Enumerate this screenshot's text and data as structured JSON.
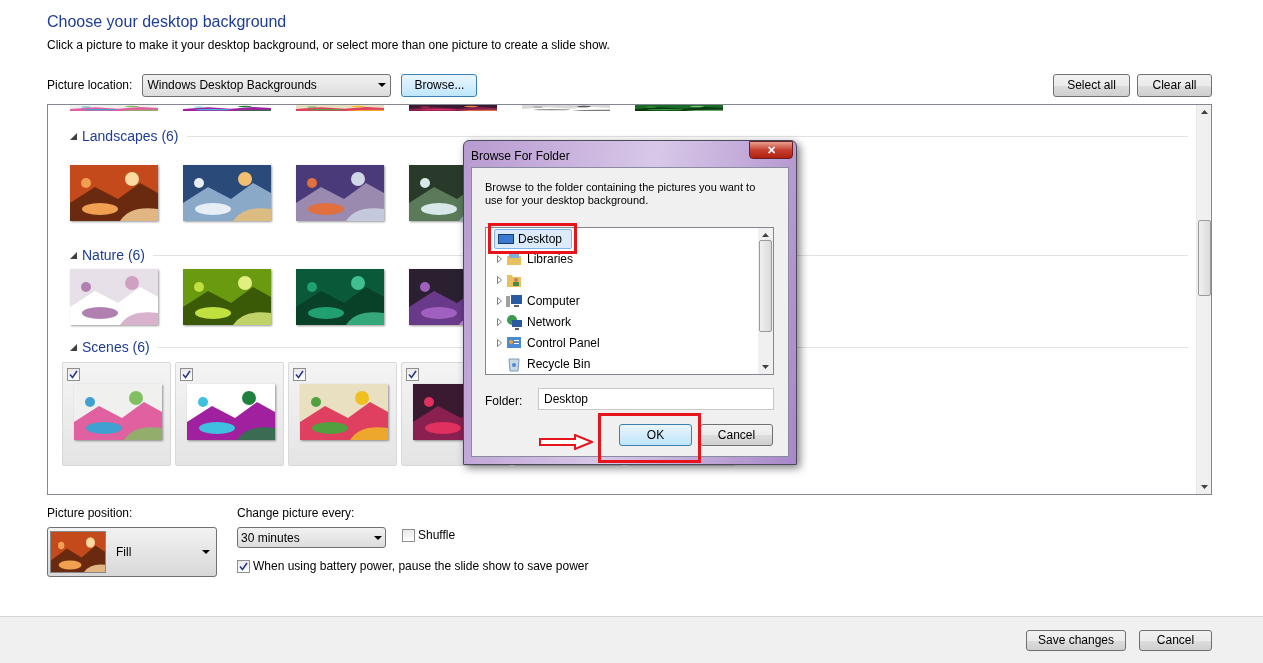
{
  "title": "Choose your desktop background",
  "description": "Click a picture to make it your desktop background, or select more than one picture to create a slide show.",
  "picture_location": {
    "label": "Picture location:",
    "value": "Windows Desktop Backgrounds",
    "browse_button": "Browse..."
  },
  "select_all_button": "Select all",
  "clear_all_button": "Clear all",
  "gallery": {
    "top_row": [
      {
        "kind": "picture"
      },
      {
        "kind": "picture"
      },
      {
        "kind": "picture"
      },
      {
        "kind": "picture"
      },
      {
        "kind": "picture"
      },
      {
        "kind": "picture"
      }
    ],
    "groups": [
      {
        "label": "Landscapes (6)",
        "expanded": true,
        "kind": "plain",
        "pictures": [
          {
            "kind": "picture"
          },
          {
            "kind": "picture"
          },
          {
            "kind": "picture"
          },
          {
            "kind": "picture"
          }
        ]
      },
      {
        "label": "Nature (6)",
        "expanded": true,
        "kind": "plain",
        "pictures": [
          {
            "kind": "picture"
          },
          {
            "kind": "picture"
          },
          {
            "kind": "picture"
          },
          {
            "kind": "picture"
          }
        ]
      },
      {
        "label": "Scenes (6)",
        "expanded": true,
        "kind": "checkable",
        "pictures": [
          {
            "kind": "picture",
            "checked": true
          },
          {
            "kind": "picture",
            "checked": true
          },
          {
            "kind": "picture",
            "checked": true
          },
          {
            "kind": "picture",
            "checked": true
          }
        ]
      }
    ]
  },
  "picture_position": {
    "label": "Picture position:",
    "value": "Fill"
  },
  "change_picture": {
    "label": "Change picture every:",
    "value": "30 minutes"
  },
  "shuffle": {
    "label": "Shuffle",
    "checked": false
  },
  "battery": {
    "label": "When using battery power, pause the slide show to save power",
    "checked": true
  },
  "footer": {
    "save_button": "Save changes",
    "cancel_button": "Cancel"
  },
  "dialog": {
    "title": "Browse For Folder",
    "close_button": "✕",
    "instructions": "Browse to the folder containing the pictures you want to use for your desktop background.",
    "tree": {
      "label": "Desktop",
      "selected": true,
      "children": [
        {
          "label": "Libraries",
          "kind": "libraries",
          "expandable": true,
          "selected": false
        },
        {
          "kind": "user",
          "expandable": true,
          "selected": false
        },
        {
          "label": "Computer",
          "kind": "computer",
          "expandable": true,
          "selected": false
        },
        {
          "label": "Network",
          "kind": "network",
          "expandable": true,
          "selected": false
        },
        {
          "label": "Control Panel",
          "kind": "control-panel",
          "expandable": true,
          "selected": false
        },
        {
          "label": "Recycle Bin",
          "kind": "recycle-bin",
          "expandable": false,
          "selected": false
        }
      ]
    },
    "folder_label": "Folder:",
    "folder_value": "Desktop",
    "ok_button": "OK",
    "cancel_button": "Cancel"
  }
}
